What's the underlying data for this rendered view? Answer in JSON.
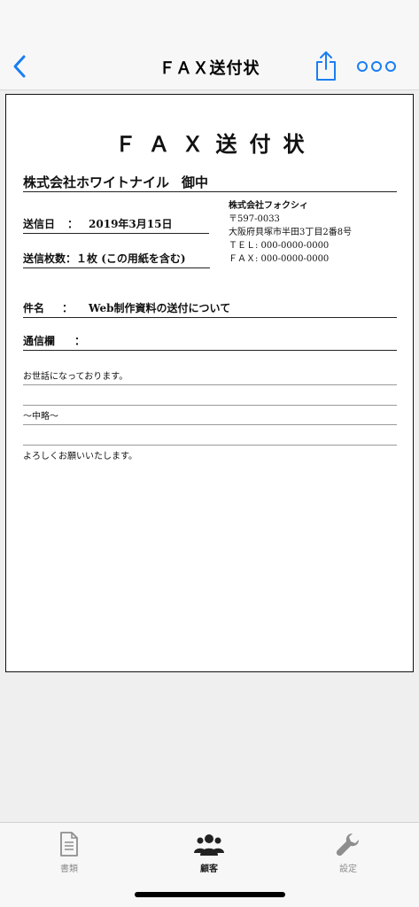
{
  "navbar": {
    "title": "ＦＡＸ送付状",
    "back_icon": "chevron-left-icon",
    "share_icon": "share-icon",
    "more_icon": "more-dots-icon",
    "accent_color": "#1a7ef2"
  },
  "document": {
    "title": "ＦＡＸ送付状",
    "recipient": {
      "name": "株式会社ホワイトナイル",
      "suffix": "御中"
    },
    "send_date": {
      "label": "送信日",
      "colon": "：",
      "value": "2019年3月15日"
    },
    "page_count": {
      "label": "送信枚数：",
      "value": "１枚 (この用紙を含む)"
    },
    "sender": {
      "company": "株式会社フォクシィ",
      "postal": "〒597-0033",
      "address": "大阪府貝塚市半田3丁目2番8号",
      "tel": "ＴＥＬ: 000-0000-0000",
      "fax": "ＦＡＸ: 000-0000-0000"
    },
    "subject": {
      "label": "件名",
      "colon": "：",
      "value": "Web制作資料の送付について"
    },
    "communication": {
      "label": "通信欄",
      "colon": "："
    },
    "message_lines": [
      "お世話になっております。",
      "",
      "〜中略〜",
      "",
      "よろしくお願いいたします。"
    ]
  },
  "tabbar": {
    "tabs": [
      {
        "label": "書類",
        "icon": "document-icon",
        "active": false
      },
      {
        "label": "顧客",
        "icon": "people-icon",
        "active": true
      },
      {
        "label": "設定",
        "icon": "wrench-icon",
        "active": false
      }
    ],
    "active_color": "#222222",
    "inactive_color": "#8e8e8e"
  }
}
